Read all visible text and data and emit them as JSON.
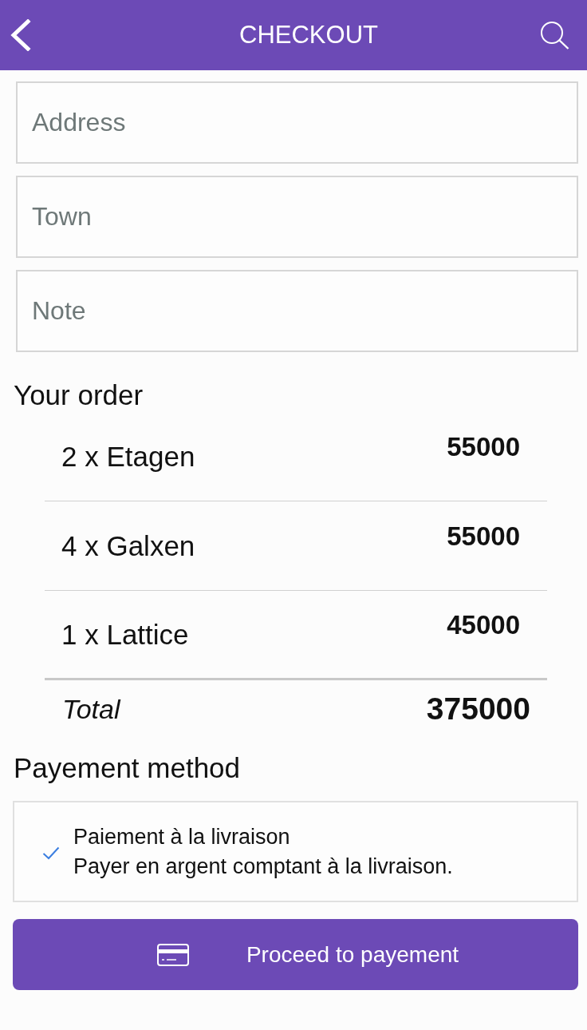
{
  "header": {
    "title": "CHECKOUT"
  },
  "fields": [
    {
      "placeholder": "Address"
    },
    {
      "placeholder": "Town"
    },
    {
      "placeholder": "Note"
    }
  ],
  "order": {
    "heading": "Your order",
    "items": [
      {
        "label": "2 x Etagen",
        "price": "55000"
      },
      {
        "label": "4 x Galxen",
        "price": "55000"
      },
      {
        "label": "1 x Lattice",
        "price": "45000"
      }
    ],
    "total": {
      "label": "Total",
      "value": "375000"
    }
  },
  "payment": {
    "heading": "Payement method",
    "methods": [
      {
        "title": "Paiement à la livraison",
        "description": "Payer en argent comptant à la livraison.",
        "selected": true
      }
    ]
  },
  "proceed_button": {
    "label": "Proceed to payement"
  }
}
